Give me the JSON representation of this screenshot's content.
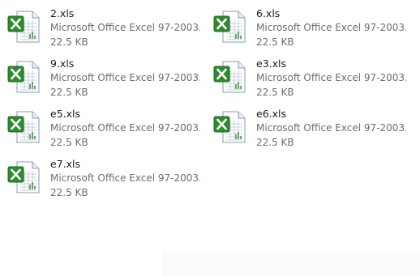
{
  "files": [
    {
      "name": "2.xls",
      "type": "Microsoft Office Excel 97-2003...",
      "size": "22.5 KB",
      "icon": "excel-file-icon"
    },
    {
      "name": "6.xls",
      "type": "Microsoft Office Excel 97-2003...",
      "size": "22.5 KB",
      "icon": "excel-file-icon"
    },
    {
      "name": "9.xls",
      "type": "Microsoft Office Excel 97-2003...",
      "size": "22.5 KB",
      "icon": "excel-file-icon"
    },
    {
      "name": "e3.xls",
      "type": "Microsoft Office Excel 97-2003...",
      "size": "22.5 KB",
      "icon": "excel-file-icon"
    },
    {
      "name": "e5.xls",
      "type": "Microsoft Office Excel 97-2003...",
      "size": "22.5 KB",
      "icon": "excel-file-icon"
    },
    {
      "name": "e6.xls",
      "type": "Microsoft Office Excel 97-2003...",
      "size": "22.5 KB",
      "icon": "excel-file-icon"
    },
    {
      "name": "e7.xls",
      "type": "Microsoft Office Excel 97-2003...",
      "size": "22.5 KB",
      "icon": "excel-file-icon"
    }
  ],
  "colors": {
    "excel_green": "#2e8b2e",
    "excel_dark_green": "#1d6b1d",
    "name_text": "#1a1a1a",
    "meta_text": "#6d6d6d"
  }
}
